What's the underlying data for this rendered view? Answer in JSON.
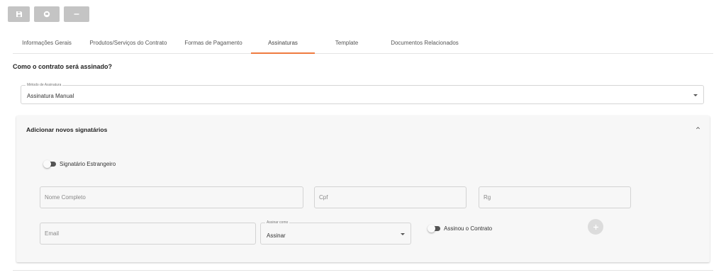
{
  "toolbar": {
    "buttons": [
      {
        "icon": "save-icon"
      },
      {
        "icon": "print-icon"
      },
      {
        "icon": "minus-icon"
      }
    ]
  },
  "tabs": [
    {
      "label": "Informações Gerais",
      "active": false
    },
    {
      "label": "Produtos/Serviços do Contrato",
      "active": false
    },
    {
      "label": "Formas de Pagamento",
      "active": false
    },
    {
      "label": "Assinaturas",
      "active": true
    },
    {
      "label": "Template",
      "active": false
    },
    {
      "label": "Documentos Relacionados",
      "active": false
    }
  ],
  "colors": {
    "accent": "#ef7b3f",
    "panel_bg": "#f7f7f7",
    "toolbar_button": "#c4c4c4"
  },
  "question": "Como o contrato será assinado?",
  "signature_method": {
    "legend": "Método de Assinatura",
    "value": "Assinatura Manual"
  },
  "panel": {
    "title": "Adicionar novos signatários",
    "foreign_toggle": {
      "label": "Signatário Estrangeiro",
      "checked": false
    },
    "fields": {
      "full_name": {
        "placeholder": "Nome Completo"
      },
      "cpf": {
        "placeholder": "Cpf"
      },
      "rg": {
        "placeholder": "Rg"
      },
      "email": {
        "placeholder": "Email"
      }
    },
    "sign_as": {
      "legend": "Assinar como",
      "value": "Assinar"
    },
    "signed_toggle": {
      "label": "Assinou o Contrato",
      "checked": false
    }
  }
}
